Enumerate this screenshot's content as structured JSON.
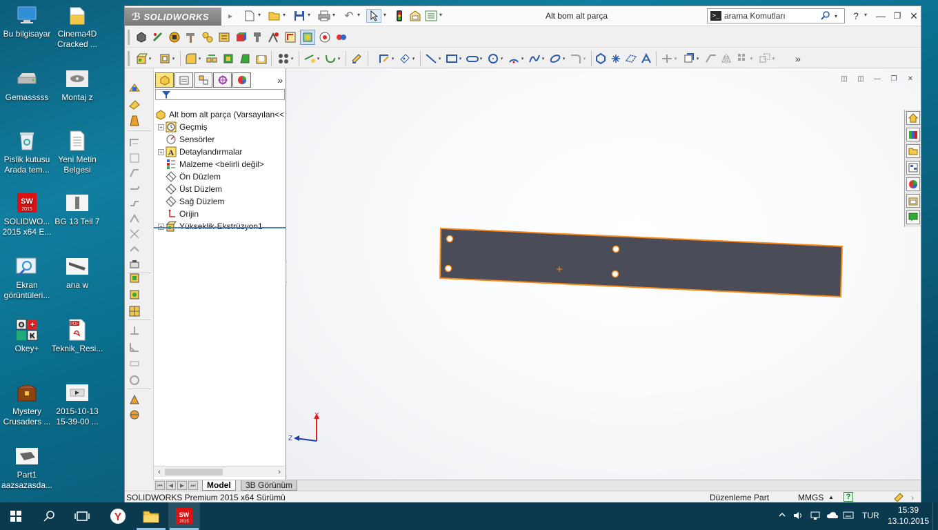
{
  "desktop": {
    "icons": [
      {
        "label": "Bu bilgisayar",
        "icon": "computer-icon"
      },
      {
        "label": "Cinema4D Cracked ...",
        "icon": "folder-icon"
      },
      {
        "label": "Gemasssss",
        "icon": "drive-icon"
      },
      {
        "label": "Montaj z",
        "icon": "assembly-file-icon"
      },
      {
        "label": "Pislik kutusu Arada tem...",
        "icon": "recycle-bin-icon"
      },
      {
        "label": "Yeni Metin Belgesi",
        "icon": "text-file-icon"
      },
      {
        "label": "SOLIDWO... 2015 x64 E...",
        "icon": "solidworks-app-icon"
      },
      {
        "label": "BG 13 Teil 7",
        "icon": "part-file-icon"
      },
      {
        "label": "Ekran görüntüleri...",
        "icon": "screenshots-folder-icon"
      },
      {
        "label": "ana w",
        "icon": "part-file-icon"
      },
      {
        "label": "Okey+",
        "icon": "okey-game-icon"
      },
      {
        "label": "Teknik_Resi...",
        "icon": "pdf-file-icon"
      },
      {
        "label": "Mystery Crusaders ...",
        "icon": "game-chest-icon"
      },
      {
        "label": "2015-10-13 15-39-00 ...",
        "icon": "video-file-icon"
      },
      {
        "label": "Part1 aazsazasda...",
        "icon": "part-file-icon"
      }
    ]
  },
  "app": {
    "logo_text": "SOLIDWORKS",
    "document_title": "Alt bom alt parça",
    "search": {
      "placeholder": "arama Komutları"
    },
    "help_label": "?"
  },
  "feature_manager": {
    "root_label": "Alt bom alt parça  (Varsayılan<<",
    "items": [
      {
        "label": "Geçmiş",
        "icon": "history-icon",
        "expandable": true
      },
      {
        "label": "Sensörler",
        "icon": "sensors-icon",
        "expandable": false
      },
      {
        "label": "Detaylandırmalar",
        "icon": "annotations-icon",
        "expandable": true
      },
      {
        "label": "Malzeme <belirli değil>",
        "icon": "material-icon",
        "expandable": false
      },
      {
        "label": "Ön Düzlem",
        "icon": "plane-icon",
        "expandable": false
      },
      {
        "label": "Üst Düzlem",
        "icon": "plane-icon",
        "expandable": false
      },
      {
        "label": "Sağ Düzlem",
        "icon": "plane-icon",
        "expandable": false
      },
      {
        "label": "Orijin",
        "icon": "origin-icon",
        "expandable": false
      },
      {
        "label": "Yükseklik-Ekstrüzyon1",
        "icon": "extrude-icon",
        "expandable": true
      }
    ]
  },
  "triad": {
    "x_label": "X",
    "z_label": "Z"
  },
  "bottom_tabs": {
    "model": "Model",
    "view3d": "3B Görünüm"
  },
  "status_bar": {
    "product": "SOLIDWORKS Premium 2015 x64 Sürümü",
    "mode": "Düzenleme Part",
    "units": "MMGS",
    "units_arrow": "▲"
  },
  "taskbar": {
    "language": "TUR",
    "time": "15:39",
    "date": "13.10.2015"
  },
  "colors": {
    "part_face": "#4a4d57",
    "part_edge": "#ff8a1c",
    "selection_yellow": "#ffe27a",
    "taskbar_bg": "#0b3a4e"
  }
}
